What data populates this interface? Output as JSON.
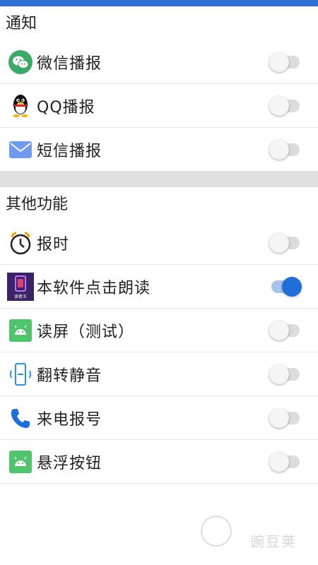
{
  "colors": {
    "accent": "#1f6fd6",
    "topbar": "#2f6fd8"
  },
  "sections": {
    "notify": {
      "title": "通知",
      "items": [
        {
          "label": "微信播报",
          "icon": "wechat-icon",
          "checked": false
        },
        {
          "label": "QQ播报",
          "icon": "qq-penguin-icon",
          "checked": false
        },
        {
          "label": "短信播报",
          "icon": "envelope-icon",
          "checked": false
        }
      ]
    },
    "other": {
      "title": "其他功能",
      "items": [
        {
          "label": "报时",
          "icon": "alarm-clock-icon",
          "checked": false
        },
        {
          "label": "本软件点击朗读",
          "icon": "app-logo-icon",
          "icon_text": "读者王",
          "checked": true
        },
        {
          "label": "读屏（测试）",
          "icon": "android-icon",
          "checked": false
        },
        {
          "label": "翻转静音",
          "icon": "phone-rotate-icon",
          "checked": false
        },
        {
          "label": "来电报号",
          "icon": "phone-icon",
          "checked": false
        },
        {
          "label": "悬浮按钮",
          "icon": "android-icon",
          "checked": false
        }
      ]
    }
  },
  "watermark": "豌豆荚"
}
